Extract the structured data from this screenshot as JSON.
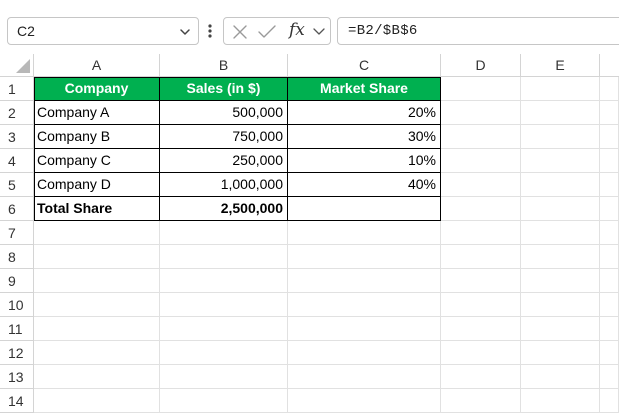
{
  "formula_bar": {
    "name_box": "C2",
    "fx_label": "fx",
    "formula": "=B2/$B$6"
  },
  "columns": [
    "A",
    "B",
    "C",
    "D",
    "E"
  ],
  "rows": [
    "1",
    "2",
    "3",
    "4",
    "5",
    "6",
    "7",
    "8",
    "9",
    "10",
    "11",
    "12",
    "13",
    "14"
  ],
  "table": {
    "headers": [
      "Company",
      "Sales (in $)",
      "Market Share"
    ],
    "body": [
      [
        "Company A",
        "500,000",
        "20%"
      ],
      [
        "Company B",
        "750,000",
        "30%"
      ],
      [
        "Company C",
        "250,000",
        "10%"
      ],
      [
        "Company D",
        "1,000,000",
        "40%"
      ]
    ],
    "total": [
      "Total Share",
      "2,500,000",
      ""
    ]
  },
  "colors": {
    "header_fill": "#00b050",
    "header_text": "#ffffff"
  }
}
